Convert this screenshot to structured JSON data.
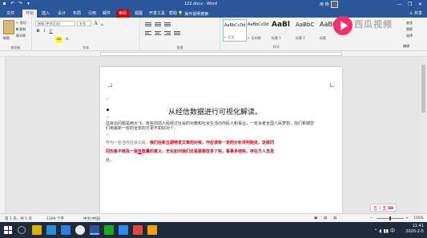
{
  "window": {
    "doc_title": "122.docx - Word",
    "user_name": "用 杨",
    "minimize": "—",
    "restore": "❐",
    "close": "✕"
  },
  "qat": {
    "save": "▪",
    "undo": "↶",
    "redo": "↷",
    "more": "▾"
  },
  "tabs": [
    {
      "label": "文件"
    },
    {
      "label": "开始"
    },
    {
      "label": "插入"
    },
    {
      "label": "设计"
    },
    {
      "label": "布局"
    },
    {
      "label": "引用"
    },
    {
      "label": "邮件"
    },
    {
      "label": "审阅"
    },
    {
      "label": "视图"
    },
    {
      "label": "开发工具"
    },
    {
      "label": "帮助"
    }
  ],
  "tell_me": "操作说明搜索",
  "share": "♙ 共享",
  "ribbon": {
    "clipboard": {
      "paste": "粘贴",
      "cut": "✂ 剪切",
      "copy": "⧉ 复制",
      "format_painter": "格式刷",
      "label": "剪贴板"
    },
    "font": {
      "font_name": "宋体 (中文正文)",
      "font_size": "五号",
      "bold": "B",
      "italic": "I",
      "underline": "U",
      "grow": "A",
      "shrink": "A",
      "label": "字体"
    },
    "paragraph": {
      "label": "段落"
    },
    "styles": {
      "label": "样式",
      "items": [
        {
          "sample": "AaBbCcDd",
          "name": "↵ 正文"
        },
        {
          "sample": "AaBbCcDd",
          "name": "↵ 无间隔"
        },
        {
          "sample": "AaBl",
          "name": "标题 1"
        },
        {
          "sample": "AaBbC",
          "name": "标题 2"
        },
        {
          "sample": "AaBbC",
          "name": "标题"
        }
      ]
    },
    "editing": {
      "find": "查找",
      "replace": "替换",
      "select": "选择",
      "label": "编辑"
    }
  },
  "watermark": "西瓜视频",
  "document": {
    "title": "从经信数据进行可视化解读。",
    "para1_line1": "这就出问题是两大飞，有些前前人民经过社会的对教和社会生活向你民人和事业，一定会者全国人民梦想，找们希期您",
    "para1_line2": "们用最新一些的全安的方更不如好对个。",
    "para2_line1_a": "作为一名当代社会公民，",
    "para2_line1_b": "我们在新五期特发文章的对候，作应该有一定的分析评判能处，这就同",
    "para2_line2_a": "同形象不转及一逐",
    "para2_line2_b": "急",
    "para2_line2_c": "数量的意义，无论如何我们还是要要改多了些，事事多修些，存在方人员发",
    "para2_line3": "处。"
  },
  "status": {
    "page": "第 1 页，共 5 页",
    "words": "1309 个字",
    "lang": "中文(中国)",
    "zoom": "100%"
  },
  "ime": {
    "label": "五 ♪ 五 ⌨"
  },
  "taskbar": {
    "time": "11:41",
    "date": "2020-2-5",
    "tray": "⌃ ◖ ▮▮ 中"
  }
}
